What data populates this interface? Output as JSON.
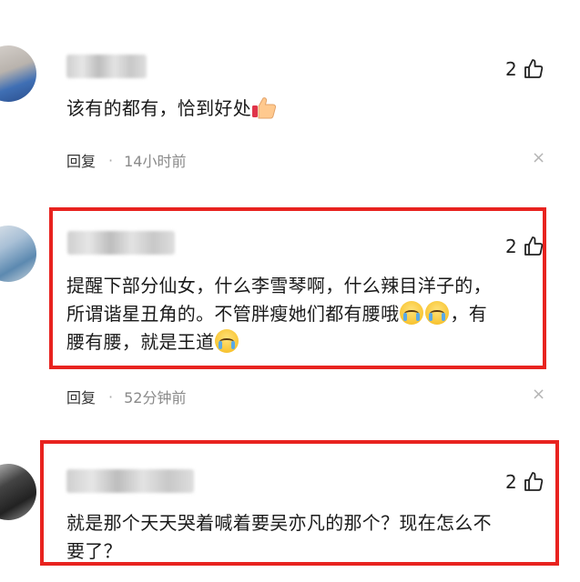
{
  "comments": [
    {
      "likes": "2",
      "text": "该有的都有，恰到好处",
      "reply_label": "回复",
      "separator": "·",
      "time": "14小时前",
      "close_glyph": "×"
    },
    {
      "likes": "2",
      "text_line1": "提醒下部分仙女，什么李雪琴啊，什么辣目洋子的，",
      "text_line2": "所谓谐星丑角的。不管胖瘦她们都有腰哦",
      "text_line2_tail": "，有",
      "text_line3": "腰有腰，就是王道",
      "reply_label": "回复",
      "separator": "·",
      "time": "52分钟前",
      "close_glyph": "×"
    },
    {
      "likes": "2",
      "text_line1": "就是那个天天哭着喊着要吴亦凡的那个？现在怎么不",
      "text_line2": "要了？"
    }
  ],
  "colors": {
    "highlight_box": "#e8231f",
    "meta_time": "#8a8a8a"
  },
  "icons": {
    "like": "thumbs-up-outline-icon",
    "close": "close-icon",
    "emoji_thumbs": "thumbs-up-emoji",
    "emoji_cry": "crying-face-emoji"
  }
}
